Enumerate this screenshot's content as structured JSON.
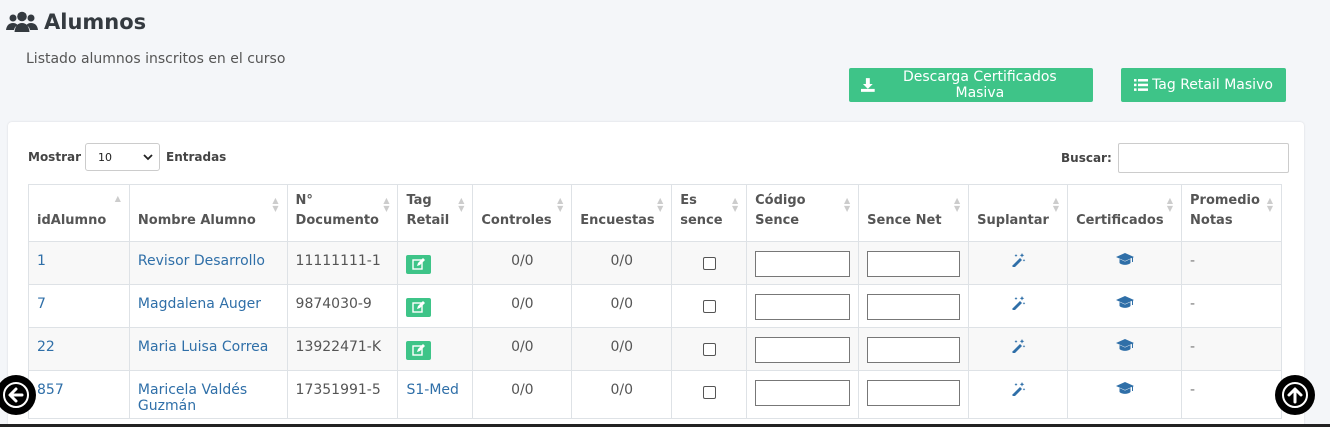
{
  "header": {
    "title": "Alumnos",
    "subtitle": "Listado alumnos inscritos en el curso"
  },
  "actions": {
    "descarga_label": "Descarga Certificados Masiva",
    "tag_label": "Tag Retail Masivo"
  },
  "table_controls": {
    "show_label": "Mostrar",
    "page_size": "10",
    "entries_label": "Entradas",
    "search_label": "Buscar:",
    "search_value": ""
  },
  "columns": [
    {
      "line1": "",
      "line2": "idAlumno"
    },
    {
      "line1": "",
      "line2": "Nombre Alumno"
    },
    {
      "line1": "N°",
      "line2": "Documento"
    },
    {
      "line1": "Tag",
      "line2": "Retail"
    },
    {
      "line1": "",
      "line2": "Controles"
    },
    {
      "line1": "",
      "line2": "Encuestas"
    },
    {
      "line1": "Es",
      "line2": "sence"
    },
    {
      "line1": "Código",
      "line2": "Sence"
    },
    {
      "line1": "",
      "line2": "Sence Net"
    },
    {
      "line1": "",
      "line2": "Suplantar"
    },
    {
      "line1": "",
      "line2": "Certificados"
    },
    {
      "line1": "Promedio",
      "line2": "Notas"
    }
  ],
  "rows": [
    {
      "id": "1",
      "name": "Revisor Desarrollo",
      "doc": "11111111-1",
      "tag": "",
      "controles": "0/0",
      "encuestas": "0/0",
      "promedio": "-"
    },
    {
      "id": "7",
      "name": "Magdalena Auger",
      "doc": "9874030-9",
      "tag": "",
      "controles": "0/0",
      "encuestas": "0/0",
      "promedio": "-"
    },
    {
      "id": "22",
      "name": "Maria Luisa Correa",
      "doc": "13922471-K",
      "tag": "",
      "controles": "0/0",
      "encuestas": "0/0",
      "promedio": "-"
    },
    {
      "id": "857",
      "name": "Maricela Valdés Guzmán",
      "doc": "17351991-5",
      "tag": "S1-Med",
      "controles": "0/0",
      "encuestas": "0/0",
      "promedio": "-"
    }
  ],
  "colors": {
    "accent_green": "#3ec488",
    "link_blue": "#2f6fa8"
  },
  "icons": [
    "users-icon",
    "download-icon",
    "list-icon",
    "edit-icon",
    "magic-wand-icon",
    "graduation-cap-icon",
    "arrow-left-icon",
    "arrow-up-icon"
  ]
}
